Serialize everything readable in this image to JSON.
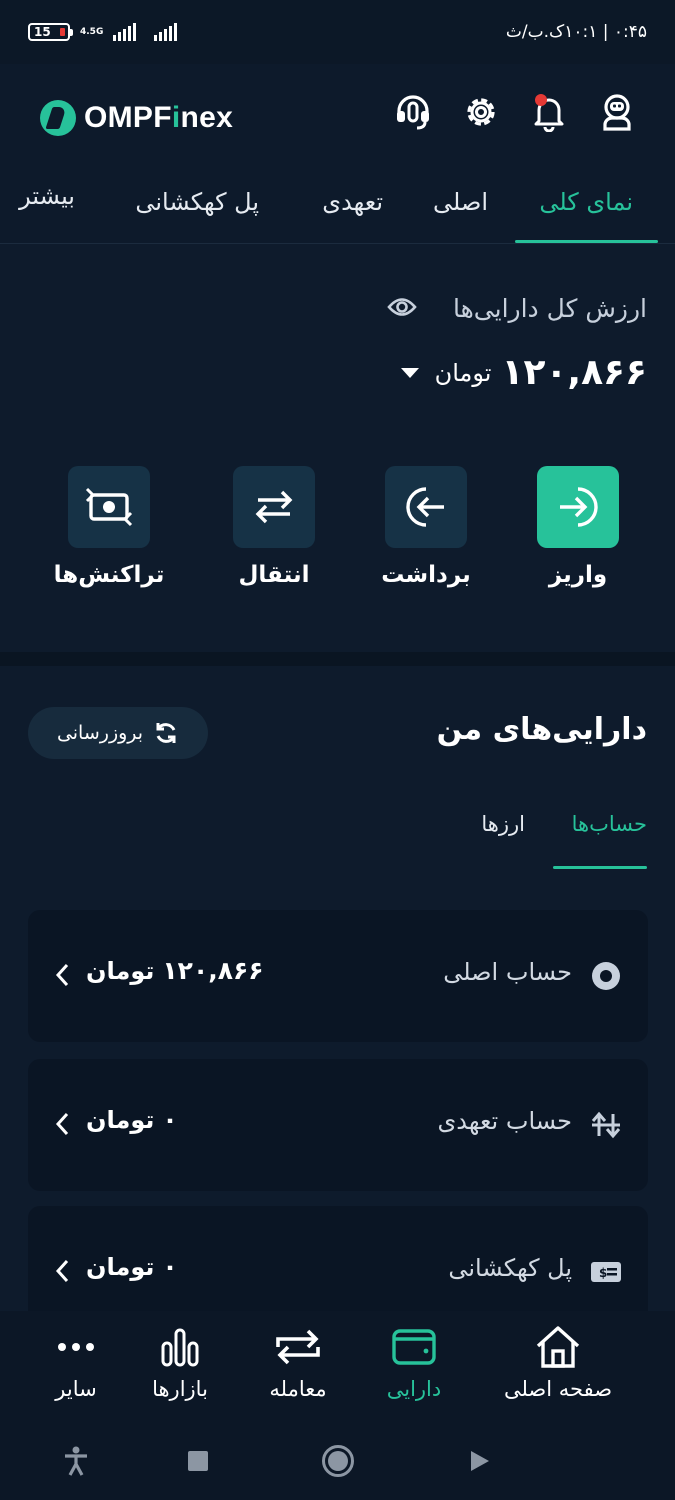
{
  "status_bar": {
    "time": "۰:۴۵ | ۱۰:۱ک.ب/ث",
    "battery": "15",
    "network": "4.5G"
  },
  "header": {
    "logo_prefix": "OMPF",
    "logo_accent": "i",
    "logo_suffix": "nex",
    "icons": [
      "headset-icon",
      "gear-icon",
      "bell-icon",
      "astronaut-icon"
    ],
    "notification_color": "#e53935"
  },
  "tabs": [
    {
      "label": "نمای کلی",
      "active": true
    },
    {
      "label": "اصلی",
      "active": false
    },
    {
      "label": "تعهدی",
      "active": false
    },
    {
      "label": "پل کهکشانی",
      "active": false
    },
    {
      "label": "بیشتر",
      "active": false
    }
  ],
  "summary": {
    "total_label": "ارزش کل دارایی‌ها",
    "total_value": "۱۲۰,۸۶۶",
    "currency": "تومان"
  },
  "actions": [
    {
      "label": "واریز",
      "icon": "deposit-icon"
    },
    {
      "label": "برداشت",
      "icon": "withdraw-icon"
    },
    {
      "label": "انتقال",
      "icon": "transfer-icon"
    },
    {
      "label": "تراکنش‌ها",
      "icon": "transactions-icon"
    }
  ],
  "assets": {
    "title": "دارایی‌های من",
    "refresh_label": "بروزرسانی",
    "sub_tabs": [
      {
        "label": "حساب‌ها",
        "active": true
      },
      {
        "label": "ارزها",
        "active": false
      }
    ],
    "accounts": [
      {
        "name": "حساب اصلی",
        "value": "۱۲۰,۸۶۶",
        "currency": "تومان",
        "icon": "radio-dot-icon"
      },
      {
        "name": "حساب تعهدی",
        "value": "۰",
        "currency": "تومان",
        "icon": "arrows-vertical-icon"
      },
      {
        "name": "پل کهکشانی",
        "value": "۰",
        "currency": "تومان",
        "icon": "dollar-card-icon"
      }
    ]
  },
  "bottom_nav": [
    {
      "label": "صفحه اصلی",
      "icon": "home-icon",
      "active": false
    },
    {
      "label": "دارایی",
      "icon": "wallet-icon",
      "active": true
    },
    {
      "label": "معامله",
      "icon": "swap-icon",
      "active": false
    },
    {
      "label": "بازارها",
      "icon": "bars-icon",
      "active": false
    },
    {
      "label": "سایر",
      "icon": "more-icon",
      "active": false
    }
  ],
  "colors": {
    "accent": "#27c29a",
    "background": "#0e1b2c",
    "card": "#0a1524",
    "action_box": "#163246"
  }
}
